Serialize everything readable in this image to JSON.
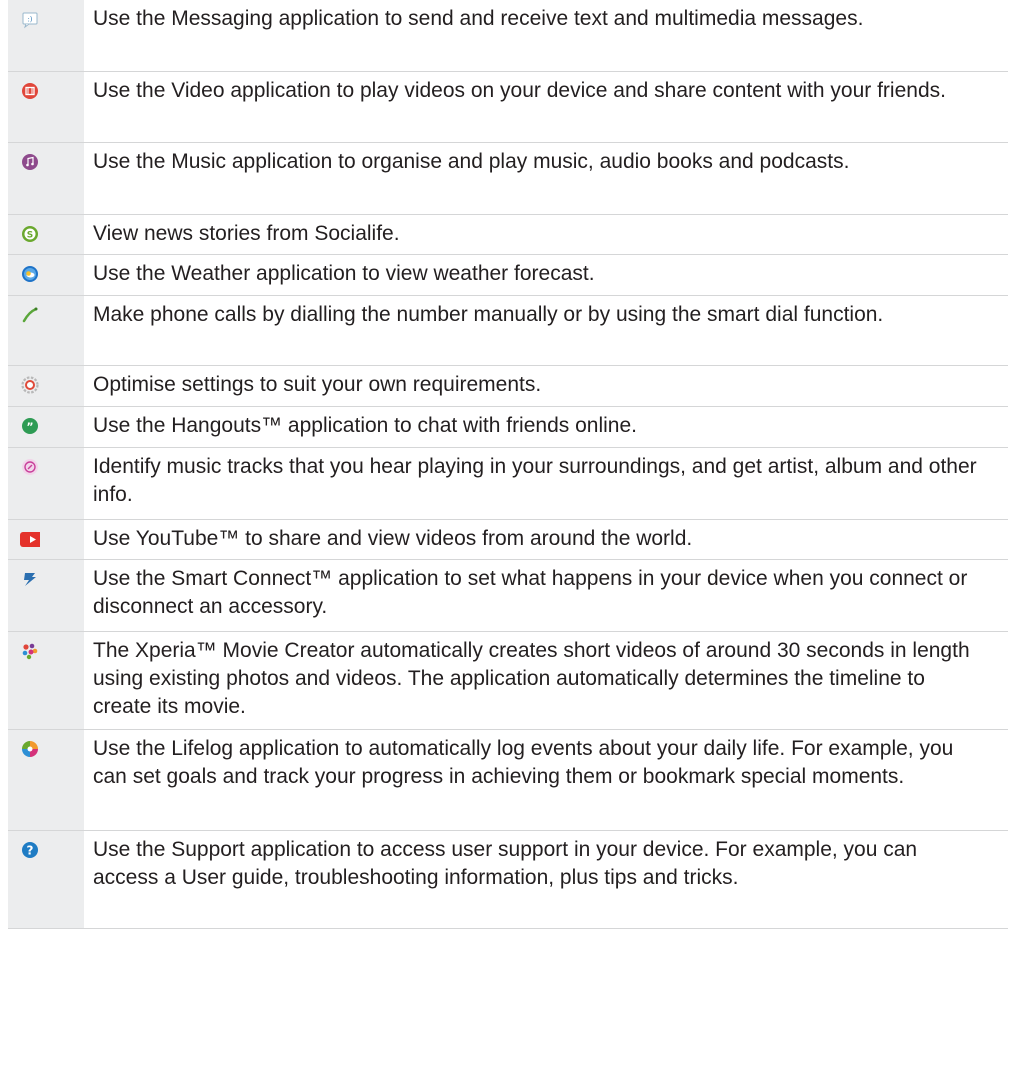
{
  "apps": [
    {
      "icon": "messaging-icon",
      "text": "Use the Messaging application to send and receive text and multimedia messages."
    },
    {
      "icon": "video-icon",
      "text": "Use the Video application to play videos on your device and share content with your friends."
    },
    {
      "icon": "music-icon",
      "text": "Use the Music application to organise and play music, audio books and podcasts."
    },
    {
      "icon": "socialife-icon",
      "text": "View news stories from Socialife."
    },
    {
      "icon": "weather-icon",
      "text": "Use the Weather application to view weather forecast."
    },
    {
      "icon": "phone-icon",
      "text": "Make phone calls by dialling the number manually or by using the smart dial function."
    },
    {
      "icon": "settings-icon",
      "text": "Optimise settings to suit your own requirements."
    },
    {
      "icon": "hangouts-icon",
      "text": "Use the Hangouts™ application to chat with friends online."
    },
    {
      "icon": "trackid-icon",
      "text": "Identify music tracks that you hear playing in your surroundings, and get artist, album and other info."
    },
    {
      "icon": "youtube-icon",
      "text": "Use YouTube™ to share and view videos from around the world."
    },
    {
      "icon": "smart-connect-icon",
      "text": "Use the Smart Connect™ application to set what happens in your device when you connect or disconnect an accessory."
    },
    {
      "icon": "movie-creator-icon",
      "text": "The Xperia™ Movie Creator automatically creates short videos of around 30 seconds in length using existing photos and videos. The application automatically determines the timeline to create its movie."
    },
    {
      "icon": "lifelog-icon",
      "text": "Use the Lifelog application to automatically log events about your daily life. For example, you can set goals and track your progress in achieving them or bookmark special moments."
    },
    {
      "icon": "support-icon",
      "text": "Use the Support application to access user support in your device. For example, you can access a User guide, troubleshooting information, plus tips and tricks."
    }
  ]
}
